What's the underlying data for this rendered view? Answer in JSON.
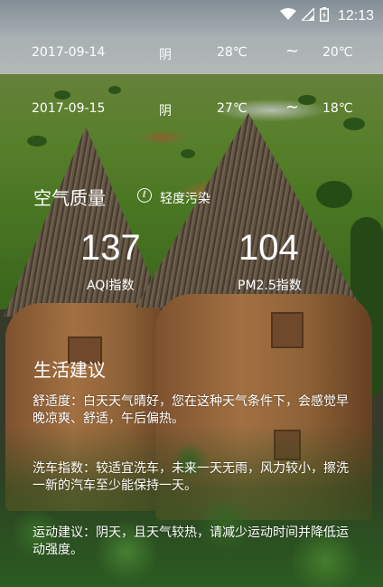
{
  "status_bar": {
    "time": "12:13"
  },
  "forecast": [
    {
      "date": "2017-09-14",
      "condition": "阴",
      "high": "28℃",
      "separator": "~",
      "low": "20℃"
    },
    {
      "date": "2017-09-15",
      "condition": "阴",
      "high": "27℃",
      "separator": "~",
      "low": "18℃"
    }
  ],
  "air_quality": {
    "title": "空气质量",
    "level": "轻度污染",
    "aqi_value": "137",
    "aqi_label": "AQI指数",
    "pm25_value": "104",
    "pm25_label": "PM2.5指数"
  },
  "life": {
    "title": "生活建议",
    "comfort": "舒适度：白天天气晴好，您在这种天气条件下，会感觉早晚凉爽、舒适，午后偏热。",
    "carwash": "洗车指数：较适宜洗车，未来一天无雨，风力较小，擦洗一新的汽车至少能保持一天。",
    "sport": "运动建议：阴天，且天气较热，请减少运动时间并降低运动强度。"
  },
  "icons": {
    "wifi": "wifi-icon",
    "signal": "signal-icon",
    "battery": "battery-icon",
    "aq_level": "air-level-icon"
  }
}
